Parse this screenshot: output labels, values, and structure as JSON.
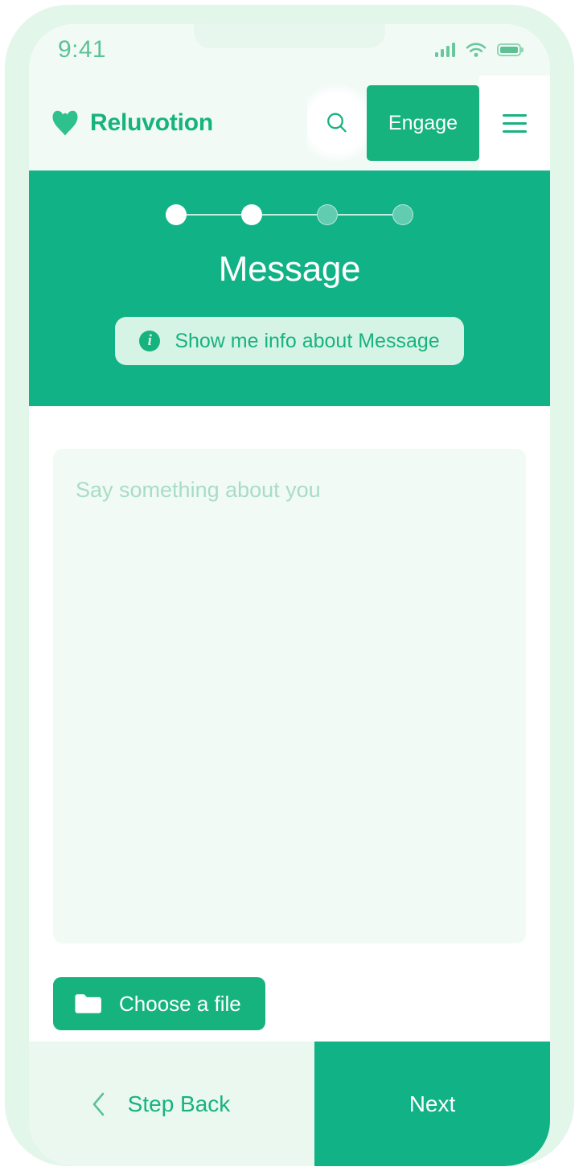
{
  "status_bar": {
    "time": "9:41",
    "signal_icon": "signal-bars-icon",
    "wifi_icon": "wifi-icon",
    "battery_icon": "battery-icon"
  },
  "navbar": {
    "logo_icon": "heart-logo-icon",
    "brand": "Reluvotion",
    "search_icon": "search-icon",
    "engage_label": "Engage",
    "menu_icon": "hamburger-menu-icon"
  },
  "hero": {
    "title": "Message",
    "steps": [
      {
        "state": "done"
      },
      {
        "state": "done"
      },
      {
        "state": "todo"
      },
      {
        "state": "todo"
      }
    ],
    "info_icon": "info-circle-icon",
    "info_label": "Show me info about Message"
  },
  "form": {
    "message_placeholder": "Say something about you",
    "message_value": "",
    "file_icon": "folder-icon",
    "file_label": "Choose a file"
  },
  "footer": {
    "back_icon": "chevron-left-icon",
    "back_label": "Step Back",
    "next_label": "Next"
  },
  "colors": {
    "brand_green": "#17b37f",
    "hero_green": "#12b287",
    "mint_bg": "#f2faf6",
    "frame_mint": "#e3f6ea",
    "pill_mint": "#d6f4e6",
    "placeholder_green": "#a8ddc4",
    "status_green": "#5ec196"
  }
}
